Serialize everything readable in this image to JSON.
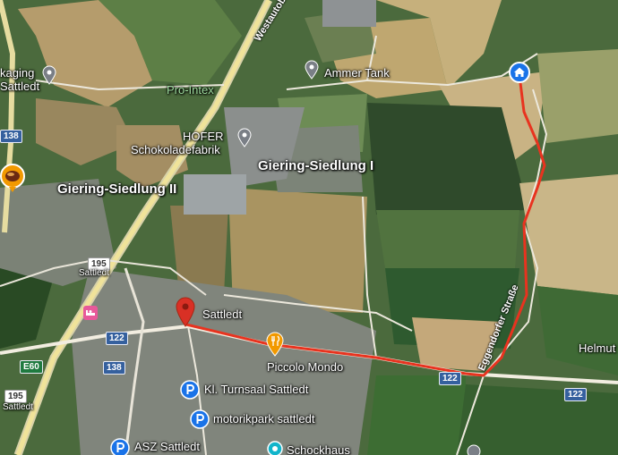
{
  "map": {
    "places": {
      "giering_siedlung_1": "Giering-Siedlung I",
      "giering_siedlung_2": "Giering-Siedlung II",
      "sattledt": "Sattledt",
      "helmut": "Helmut"
    },
    "pois": {
      "ammer_tank": "Ammer Tank",
      "hofer_line1": "HOFER",
      "hofer_line2": "Schokoladefabrik",
      "pro_intex": "Pro-Intex",
      "packaging_line1": "kaging",
      "packaging_line2": "Sattledt",
      "piccolo_mondo": "Piccolo Mondo",
      "kl_turnsaal": "Kl. Turnsaal Sattledt",
      "motorikpark": "motorikpark sattledt",
      "asz": "ASZ Sattledt",
      "schockhaus": "Schockhaus"
    },
    "roads": {
      "westautobahn": "Westautobahn",
      "eggendorfer": "Eggendorfer Straße",
      "sattledt_small": "Sattledt"
    },
    "shields": {
      "r122_a": "122",
      "r122_b": "122",
      "r122_c": "122",
      "r138_a": "138",
      "r138_b": "138",
      "r195_a": "195",
      "r195_b": "195",
      "e60": "E60"
    },
    "colors": {
      "route": "#e8331f",
      "pin_red": "#d93025",
      "pin_blue": "#1a73e8",
      "pin_gray": "#7a7f86",
      "food_orange": "#f29900"
    },
    "icons": [
      "home-icon",
      "location-pin-icon",
      "restaurant-icon",
      "parking-icon",
      "hotel-icon",
      "place-pin-icon"
    ]
  }
}
